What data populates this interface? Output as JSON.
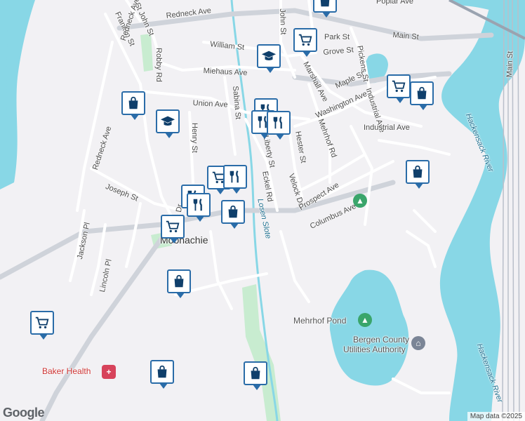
{
  "map": {
    "attribution": "Map data ©2025",
    "logo": "Google",
    "colors": {
      "water": "#88d7e6",
      "land": "#f2f1f4",
      "park": "#c8ecd0",
      "road": "#ffffff",
      "highway": "#b9bfca",
      "marker": "#2a6ca8"
    }
  },
  "labels": {
    "streets": {
      "redneck_ave_top": "Redneck Ave",
      "franklin": "Franklin St",
      "st_john": "St John St",
      "robby": "Robby Rd",
      "redneck_ave_left": "Redneck Ave",
      "redneck_ave_left2": "Redneck Ave",
      "william": "William St",
      "miehaus": "Miehaus Ave",
      "union": "Union Ave",
      "sabina": "Sabina St",
      "henry": "Henry St",
      "joseph": "Joseph St",
      "edstan": "Edstan Dr",
      "jackson": "Jackson Pl",
      "lincoln": "Lincoln Pl",
      "john": "John St",
      "park": "Park St",
      "grove": "Grove St",
      "main": "Main St",
      "poplar": "Poplar Ave",
      "marshall": "Marshall Ave",
      "maple": "Maple St",
      "pickens": "Pickens St",
      "washington": "Washington Ave",
      "industrial": "Industrial Ave",
      "hester": "Hester St",
      "mehrhof_rd": "Mehrhof Rd",
      "liberty": "Liberty St",
      "eckel": "Eckel Rd",
      "velock": "Velock Dr",
      "prospect": "Prospect Ave",
      "columbus": "Columbus Ave",
      "main_right": "Main St"
    },
    "water": {
      "losen_slote": "Losen Slote",
      "hackensack_1": "Hackensack River",
      "hackensack_2": "Hackensack River"
    },
    "places": {
      "moonachie": "Moonachie"
    },
    "pois": {
      "mehrhof_pond": "Mehrhof Pond",
      "bergen_1": "Bergen County",
      "bergen_2": "Utilities Authority",
      "baker": "Baker Health"
    }
  },
  "markers": [
    {
      "type": "shopping-bag",
      "label": "shopping"
    },
    {
      "type": "shopping-bag",
      "label": "shopping"
    },
    {
      "type": "shopping-cart",
      "label": "grocery"
    },
    {
      "type": "graduation-cap",
      "label": "school"
    },
    {
      "type": "shopping-cart",
      "label": "grocery"
    },
    {
      "type": "shopping-bag",
      "label": "shopping"
    },
    {
      "type": "graduation-cap",
      "label": "school"
    },
    {
      "type": "fork-knife",
      "label": "restaurant"
    },
    {
      "type": "fork-knife",
      "label": "restaurant"
    },
    {
      "type": "fork-knife",
      "label": "restaurant"
    },
    {
      "type": "shopping-cart",
      "label": "grocery"
    },
    {
      "type": "fork-knife",
      "label": "restaurant"
    },
    {
      "type": "shopping-bag",
      "label": "shopping"
    },
    {
      "type": "fork-knife",
      "label": "restaurant"
    },
    {
      "type": "fork-knife",
      "label": "restaurant"
    },
    {
      "type": "shopping-cart",
      "label": "grocery"
    },
    {
      "type": "shopping-bag",
      "label": "shopping"
    },
    {
      "type": "shopping-cart",
      "label": "grocery"
    },
    {
      "type": "shopping-bag",
      "label": "shopping"
    },
    {
      "type": "shopping-bag",
      "label": "shopping"
    },
    {
      "type": "shopping-bag",
      "label": "shopping"
    }
  ]
}
